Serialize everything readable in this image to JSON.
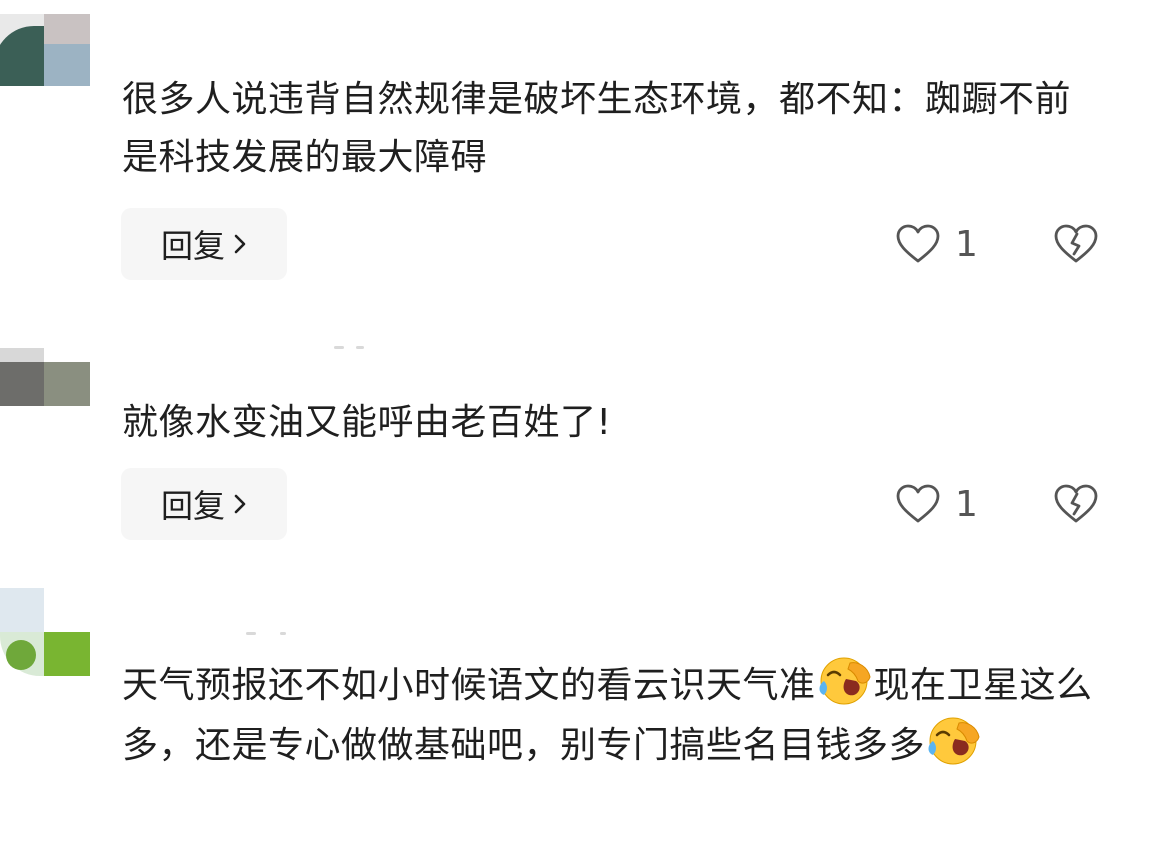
{
  "comments": [
    {
      "text": "很多人说违背自然规律是破坏生态环境，都不知：踟蹰不前是科技发展的最大障碍",
      "reply_label": "回复",
      "like_count": "1"
    },
    {
      "text": "就像水变油又能呼由老百姓了!",
      "reply_label": "回复",
      "like_count": "1"
    },
    {
      "text_part1": "天气预报还不如小时候语文的看云识天气准",
      "text_part2": "现在卫星这么多，还是专心做做基础吧，别专门搞些名目钱多多",
      "emoji": "face-with-tears-of-joy-hand-over-face"
    }
  ],
  "icons": {
    "like": "heart-outline-icon",
    "dislike": "broken-heart-outline-icon",
    "reply_chevron": "chevron-right-icon"
  },
  "colors": {
    "text": "#1f1f1f",
    "reply_bg": "#f6f6f6",
    "icon": "#555555"
  }
}
